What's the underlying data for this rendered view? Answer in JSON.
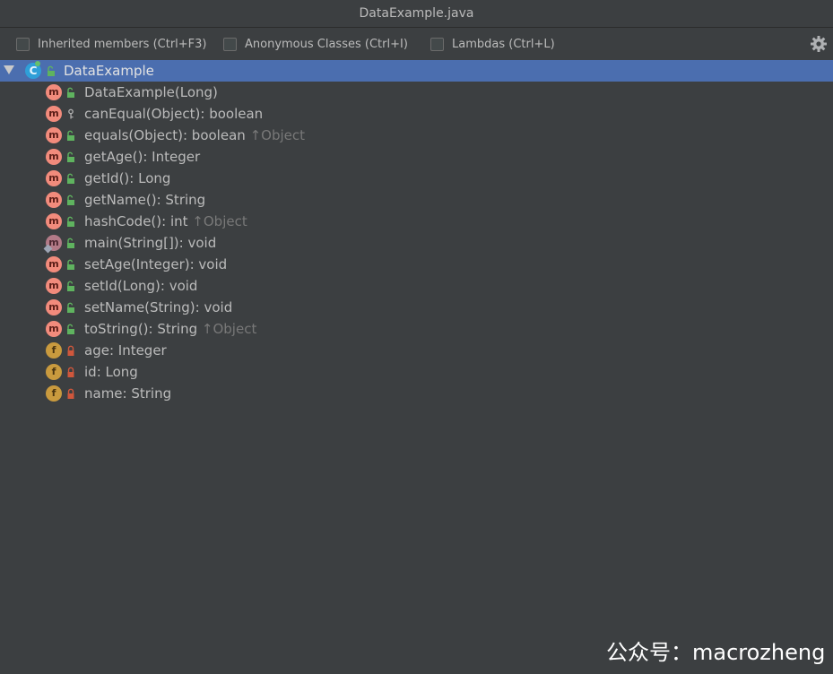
{
  "window": {
    "title": "DataExample.java"
  },
  "toolbar": {
    "options": [
      {
        "label": "Inherited members (Ctrl+F3)",
        "checked": false
      },
      {
        "label": "Anonymous Classes (Ctrl+I)",
        "checked": false
      },
      {
        "label": "Lambdas (Ctrl+L)",
        "checked": false
      }
    ],
    "settings_icon": "gear-icon"
  },
  "tree": {
    "root": {
      "label": "DataExample",
      "icon": "class-icon",
      "badge": "C",
      "expanded": true
    },
    "members": [
      {
        "kind": "method",
        "badge": "m",
        "visibility": "public",
        "label": "DataExample(Long)",
        "inherited": ""
      },
      {
        "kind": "method",
        "badge": "m",
        "visibility": "protected",
        "label": "canEqual(Object): boolean",
        "inherited": ""
      },
      {
        "kind": "method",
        "badge": "m",
        "visibility": "public",
        "label": "equals(Object): boolean",
        "inherited": "↑Object"
      },
      {
        "kind": "method",
        "badge": "m",
        "visibility": "public",
        "label": "getAge(): Integer",
        "inherited": ""
      },
      {
        "kind": "method",
        "badge": "m",
        "visibility": "public",
        "label": "getId(): Long",
        "inherited": ""
      },
      {
        "kind": "method",
        "badge": "m",
        "visibility": "public",
        "label": "getName(): String",
        "inherited": ""
      },
      {
        "kind": "method",
        "badge": "m",
        "visibility": "public",
        "label": "hashCode(): int",
        "inherited": "↑Object"
      },
      {
        "kind": "static-method",
        "badge": "m",
        "visibility": "public",
        "label": "main(String[]): void",
        "inherited": ""
      },
      {
        "kind": "method",
        "badge": "m",
        "visibility": "public",
        "label": "setAge(Integer): void",
        "inherited": ""
      },
      {
        "kind": "method",
        "badge": "m",
        "visibility": "public",
        "label": "setId(Long): void",
        "inherited": ""
      },
      {
        "kind": "method",
        "badge": "m",
        "visibility": "public",
        "label": "setName(String): void",
        "inherited": ""
      },
      {
        "kind": "method",
        "badge": "m",
        "visibility": "public",
        "label": "toString(): String",
        "inherited": "↑Object"
      },
      {
        "kind": "field",
        "badge": "f",
        "visibility": "private",
        "label": "age: Integer",
        "inherited": ""
      },
      {
        "kind": "field",
        "badge": "f",
        "visibility": "private",
        "label": "id: Long",
        "inherited": ""
      },
      {
        "kind": "field",
        "badge": "f",
        "visibility": "private",
        "label": "name: String",
        "inherited": ""
      }
    ]
  },
  "watermark": {
    "text": "公众号：macrozheng"
  },
  "colors": {
    "background": "#3c3f41",
    "selection": "#4b6eaf",
    "method_badge": "#f28b7c",
    "field_badge": "#c99a3e",
    "public_lock": "#5fb35f",
    "private_lock": "#d0573c",
    "inherited_text": "#787878"
  }
}
